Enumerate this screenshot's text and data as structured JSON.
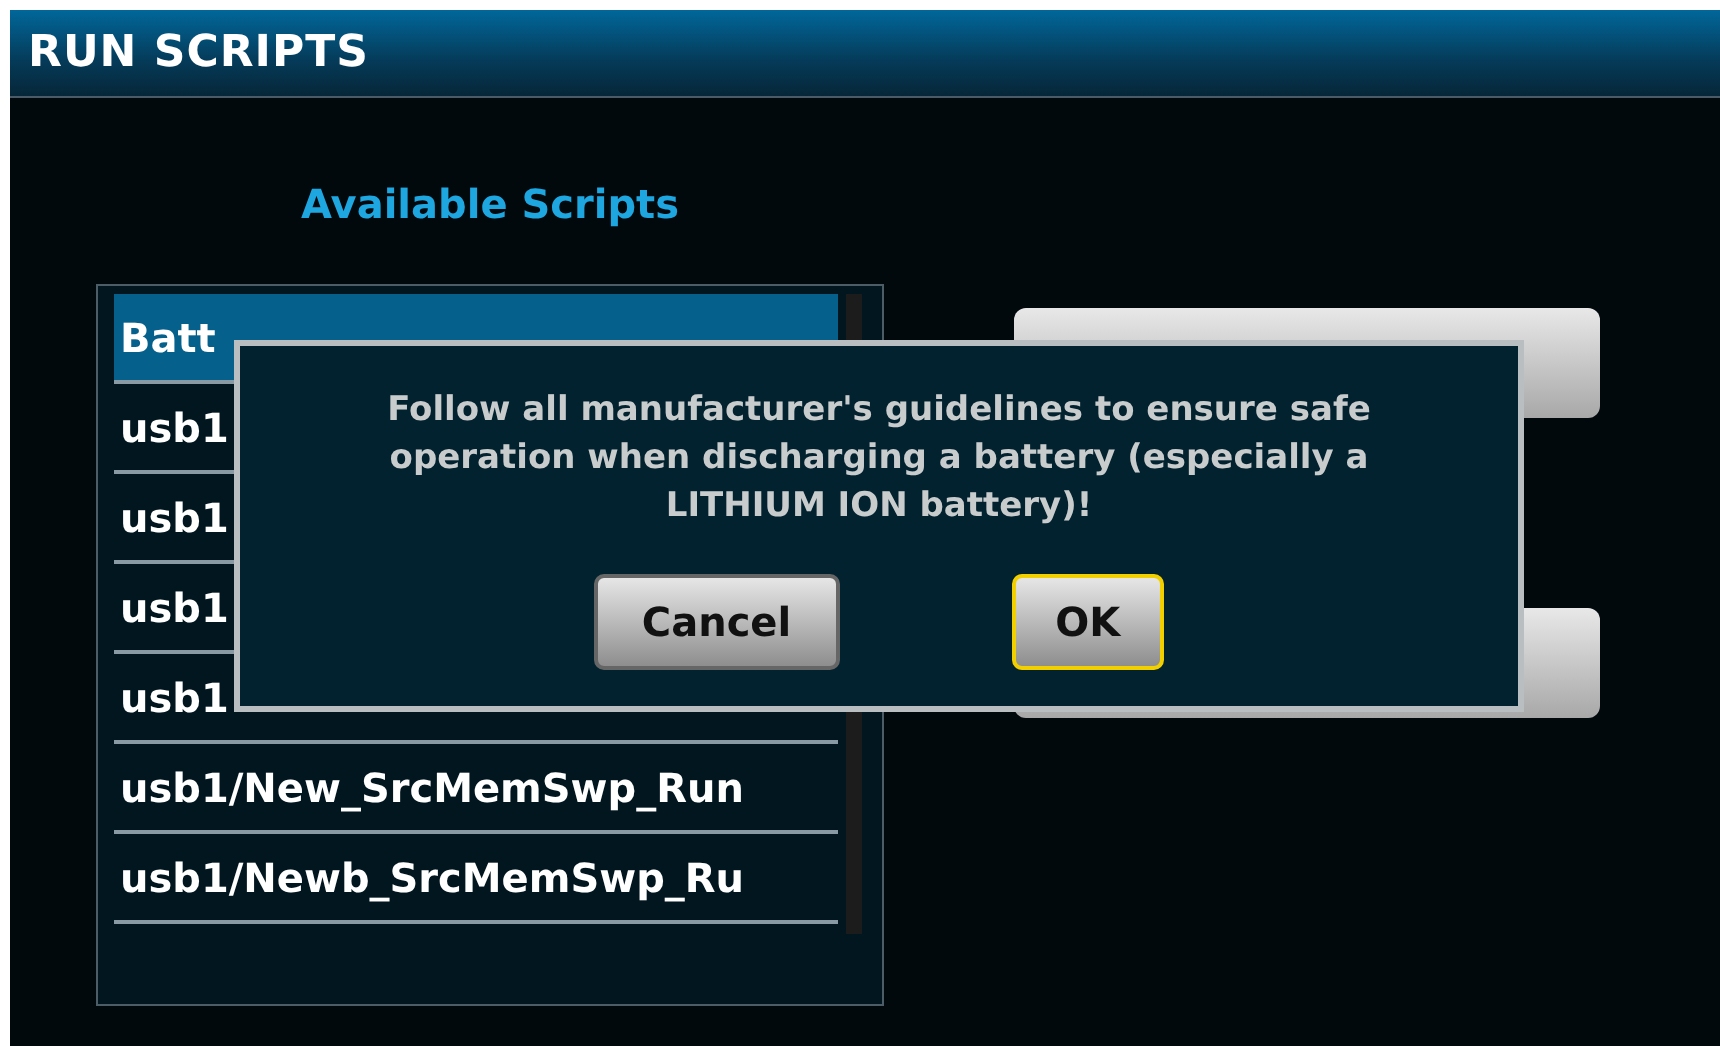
{
  "title": "RUN SCRIPTS",
  "heading": "Available Scripts",
  "scripts": [
    {
      "label": "Batt",
      "selected": true
    },
    {
      "label": "usb1",
      "selected": false
    },
    {
      "label": "usb1",
      "selected": false
    },
    {
      "label": "usb1",
      "selected": false
    },
    {
      "label": "usb1",
      "selected": false
    },
    {
      "label": "usb1/New_SrcMemSwp_Run",
      "selected": false
    },
    {
      "label": "usb1/Newb_SrcMemSwp_Ru",
      "selected": false
    }
  ],
  "dialog": {
    "message": "Follow all manufacturer's guidelines to ensure safe operation when discharging a battery (especially a LITHIUM ION battery)!",
    "buttons": [
      {
        "label": "Cancel",
        "selected": false
      },
      {
        "label": "OK",
        "selected": true
      }
    ]
  }
}
